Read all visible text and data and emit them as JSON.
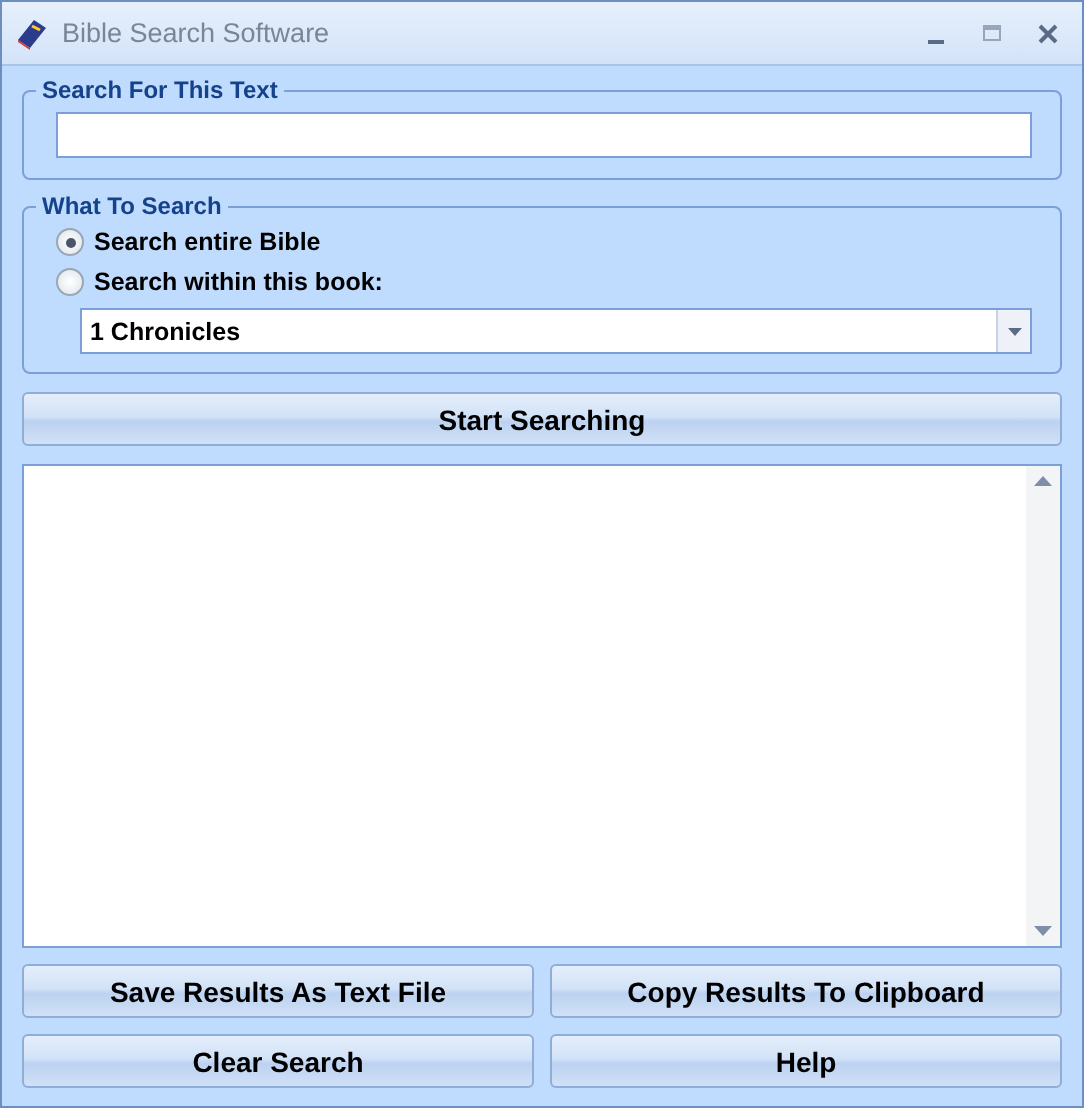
{
  "window": {
    "title": "Bible Search Software"
  },
  "search_text": {
    "legend": "Search For This Text"
  },
  "what_to_search": {
    "legend": "What To Search",
    "options": [
      {
        "label": "Search entire Bible",
        "selected": true
      },
      {
        "label": "Search within this book:",
        "selected": false
      }
    ],
    "book": "1 Chronicles"
  },
  "start_button": "Start Searching",
  "buttons": [
    "Save Results As Text File",
    "Copy Results To Clipboard",
    "Clear Search",
    "Help"
  ]
}
